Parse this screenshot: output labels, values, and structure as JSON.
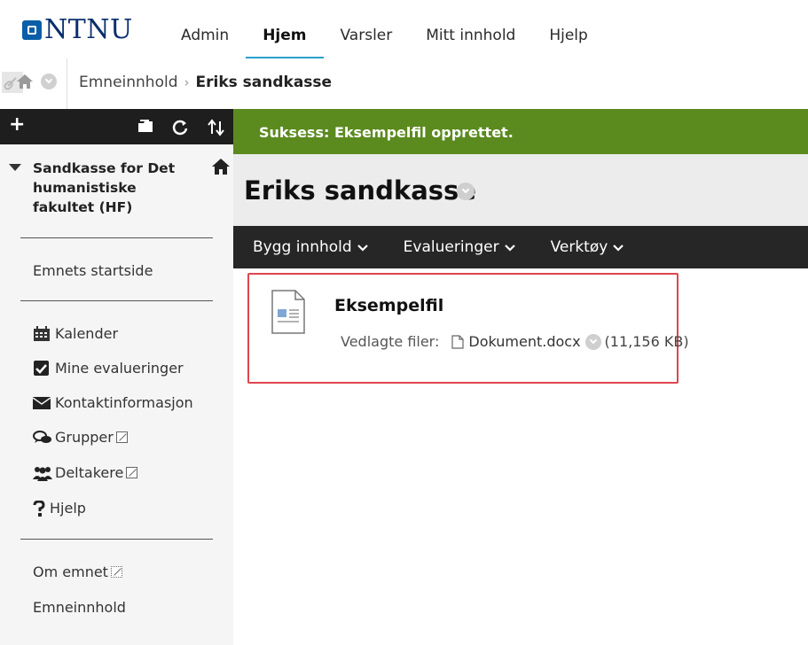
{
  "header": {
    "logo_text": "NTNU",
    "nav": [
      {
        "label": "Admin",
        "active": false
      },
      {
        "label": "Hjem",
        "active": true
      },
      {
        "label": "Varsler",
        "active": false
      },
      {
        "label": "Mitt innhold",
        "active": false
      },
      {
        "label": "Hjelp",
        "active": false
      }
    ]
  },
  "breadcrumb": {
    "parent": "Emneinnhold",
    "separator": "›",
    "current": "Eriks sandkasse"
  },
  "sidebar": {
    "course_title": "Sandkasse for Det humanistiske fakultet (HF)",
    "start_page": "Emnets startside",
    "tools": [
      {
        "label": "Kalender",
        "icon": "calendar-icon",
        "external": false
      },
      {
        "label": "Mine evalueringer",
        "icon": "checkbox-icon",
        "external": false
      },
      {
        "label": "Kontaktinformasjon",
        "icon": "envelope-icon",
        "external": false
      },
      {
        "label": "Grupper",
        "icon": "chat-bubbles-icon",
        "external": true
      },
      {
        "label": "Deltakere",
        "icon": "people-icon",
        "external": true
      },
      {
        "label": "Hjelp",
        "icon": "question-icon",
        "external": false
      }
    ],
    "about": "Om emnet",
    "content": "Emneinnhold"
  },
  "main": {
    "success_message": "Suksess: Eksempelfil opprettet.",
    "page_title": "Eriks sandkasse",
    "actions": [
      {
        "label": "Bygg innhold"
      },
      {
        "label": "Evalueringer"
      },
      {
        "label": "Verktøy"
      }
    ],
    "item": {
      "title": "Eksempelfil",
      "attachments_label": "Vedlagte filer:",
      "file_name": "Dokument.docx",
      "file_size": "(11,156 KB)"
    }
  },
  "colors": {
    "success_bg": "#5b8a1f",
    "toolbar_bg": "#262626",
    "highlight_border": "#e0454f",
    "nav_active_underline": "#2aa0c8",
    "logo_blue": "#0a5ea8"
  }
}
